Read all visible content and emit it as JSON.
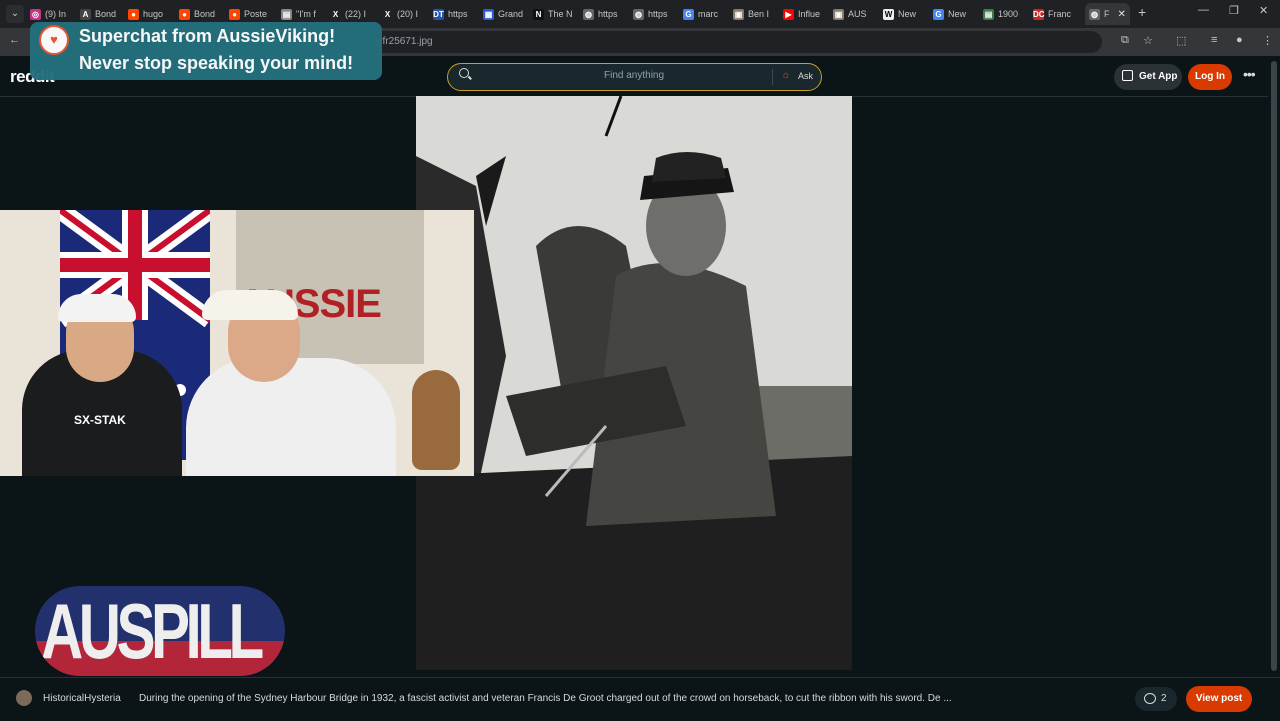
{
  "browser": {
    "tabs": [
      {
        "label": "(9) In",
        "favicon": "instagram-icon",
        "color": "#c13584"
      },
      {
        "label": "Bond",
        "favicon": "a-icon",
        "color": "#444444"
      },
      {
        "label": "hugo",
        "favicon": "reddit-icon",
        "color": "#ff4500"
      },
      {
        "label": "Bond",
        "favicon": "reddit-icon",
        "color": "#ff4500"
      },
      {
        "label": "Poste",
        "favicon": "reddit-icon",
        "color": "#ff4500"
      },
      {
        "label": "\"I'm f",
        "favicon": "doc-icon",
        "color": "#888888"
      },
      {
        "label": "(22) I",
        "favicon": "x-icon",
        "color": "#222222"
      },
      {
        "label": "(20) I",
        "favicon": "x-icon",
        "color": "#222222"
      },
      {
        "label": "https",
        "favicon": "dt-icon",
        "color": "#2255aa"
      },
      {
        "label": "Grand",
        "favicon": "grid-icon",
        "color": "#2a5bd7"
      },
      {
        "label": "The N",
        "favicon": "n-icon",
        "color": "#111111"
      },
      {
        "label": "https",
        "favicon": "globe-icon",
        "color": "#666666"
      },
      {
        "label": "https",
        "favicon": "globe-icon",
        "color": "#666666"
      },
      {
        "label": "marc",
        "favicon": "google-icon",
        "color": "#4285f4"
      },
      {
        "label": "Ben I",
        "favicon": "image-icon",
        "color": "#8a7a6a"
      },
      {
        "label": "Influe",
        "favicon": "youtube-icon",
        "color": "#ff0000"
      },
      {
        "label": "AUS",
        "favicon": "image-icon",
        "color": "#8a7a6a"
      },
      {
        "label": "New",
        "favicon": "w-icon",
        "color": "#eeeeee"
      },
      {
        "label": "New",
        "favicon": "google-icon",
        "color": "#4285f4"
      },
      {
        "label": "1900",
        "favicon": "doc-icon",
        "color": "#3b7d4a"
      },
      {
        "label": "Franc",
        "favicon": "dc-icon",
        "color": "#c62828"
      },
      {
        "label": "F",
        "favicon": "globe-icon",
        "color": "#666666",
        "active": true
      }
    ],
    "url": "eyfr25671.jpg",
    "new_tab": "+",
    "window_controls": {
      "minimize": "—",
      "restore": "❐",
      "close": "✕"
    }
  },
  "superchat": {
    "line1": "Superchat from AussieViking!",
    "line2": "Never stop speaking your mind!"
  },
  "reddit": {
    "logo": "reddit",
    "search_placeholder": "Find anything",
    "ask_label": "Ask",
    "get_app_label": "Get App",
    "login_label": "Log In",
    "more_label": "•••"
  },
  "webcam": {
    "poster_text": "AUSSIE",
    "shirt_text": "SX-STAK"
  },
  "channel_logo": {
    "text": "AUSPILL"
  },
  "post": {
    "username": "HistoricalHysteria",
    "title": "During the opening of the Sydney Harbour Bridge in 1932, a fascist activist and veteran Francis De Groot charged out of the crowd on horseback, to cut the ribbon with his sword. De ...",
    "comment_count": "2",
    "view_label": "View post"
  }
}
